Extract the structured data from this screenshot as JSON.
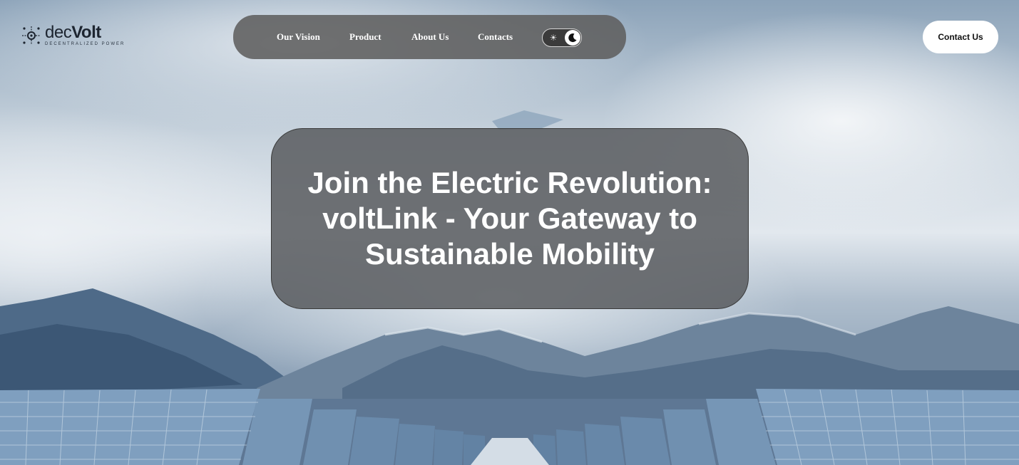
{
  "brand": {
    "name_light": "dec",
    "name_bold": "Volt",
    "tagline": "DECENTRALIZED POWER",
    "logo_icon": "circuit-node-icon"
  },
  "nav": {
    "items": [
      {
        "label": "Our Vision"
      },
      {
        "label": "Product"
      },
      {
        "label": "About Us"
      },
      {
        "label": "Contacts"
      }
    ],
    "theme_toggle": {
      "sun_icon": "sun-icon",
      "moon_icon": "moon-icon",
      "state": "dark"
    }
  },
  "header": {
    "contact_label": "Contact Us"
  },
  "hero": {
    "title": "Join the Electric Revolution: voltLink - Your Gateway to Sustainable Mobility"
  },
  "colors": {
    "nav_bg": "#5f5f5f",
    "hero_bg": "#5a5c60",
    "button_bg": "#ffffff",
    "text_light": "#ffffff"
  }
}
